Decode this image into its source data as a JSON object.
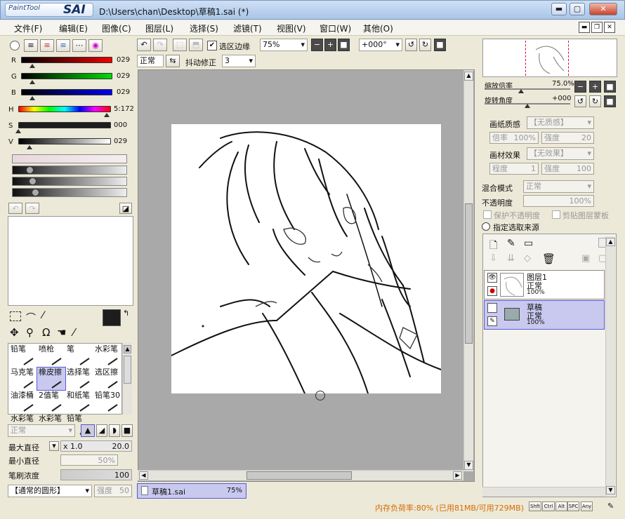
{
  "window": {
    "app_logo_small": "PaintTool",
    "app_logo_big": "SAI",
    "title": "D:\\Users\\chan\\Desktop\\草稿1.sai (*)",
    "btn_min": "▬",
    "btn_max": "▢",
    "btn_close": "✕"
  },
  "menu": {
    "items": [
      "文件(F)",
      "编辑(E)",
      "图像(C)",
      "图层(L)",
      "选择(S)",
      "滤镜(T)",
      "视图(V)",
      "窗口(W)",
      "其他(O)"
    ]
  },
  "toolbar": {
    "selection_edge_label": "选区边缘",
    "zoom_value": "75%",
    "rotation_value": "+000°",
    "blend_mode": "正常",
    "stabilizer_label": "抖动修正",
    "stabilizer_value": "3"
  },
  "color": {
    "r_label": "R",
    "r_value": "029",
    "g_label": "G",
    "g_value": "029",
    "b_label": "B",
    "b_value": "029",
    "h_label": "H",
    "h_value": "5:172",
    "s_label": "S",
    "s_value": "000",
    "v_label": "V",
    "v_value": "029",
    "primary": "#1d1d1d",
    "secondary": "#ffffff"
  },
  "tools": {
    "row1": [
      "铅笔",
      "喷枪",
      "笔",
      "水彩笔"
    ],
    "row2": [
      "马克笔",
      "橡皮擦",
      "选择笔",
      "选区擦"
    ],
    "row3": [
      "油漆桶",
      "2值笔",
      "和纸笔",
      "铅笔30"
    ],
    "row4": [
      "水彩笔",
      "水彩笔",
      "铅笔"
    ],
    "selected": "橡皮擦"
  },
  "brush": {
    "mode": "正常",
    "max_size_label": "最大直径",
    "max_size_mult": "x 1.0",
    "max_size_value": "20.0",
    "min_size_label": "最小直径",
    "min_size_value": "50%",
    "density_label": "笔刷浓度",
    "density_value": "100",
    "shape_label": "【通常的圆形】",
    "strength_label": "强度",
    "strength_value": "50"
  },
  "document_tab": {
    "name": "草稿1.sai",
    "zoom": "75%"
  },
  "status": {
    "text": "内存负荷率:80% (已用81MB/可用729MB)",
    "keys": [
      "Shft",
      "Ctrl",
      "Alt",
      "SPC",
      "Any"
    ]
  },
  "navigator": {
    "zoom_label": "缩放倍率",
    "zoom_value": "75.0%",
    "rotate_label": "旋转角度",
    "rotate_value": "+000"
  },
  "layer_props": {
    "paper_texture_label": "画纸质感",
    "paper_texture_value": "【无质感】",
    "ratio_label": "倍率",
    "ratio_value": "100%",
    "strength_label": "强度",
    "strength_value": "20",
    "effect_label": "画材效果",
    "effect_value": "【无效果】",
    "degree_label": "程度",
    "degree_value": "1",
    "strength2_label": "强度",
    "strength2_value": "100",
    "blend_label": "混合模式",
    "blend_value": "正常",
    "opacity_label": "不透明度",
    "opacity_value": "100%",
    "protect_label": "保护不透明度",
    "clip_label": "剪贴图层蒙板",
    "source_label": "指定选取来源"
  },
  "layers": [
    {
      "name": "图层1",
      "mode": "正常",
      "opacity": "100%",
      "type": "layer"
    },
    {
      "name": "草稿",
      "mode": "正常",
      "opacity": "100%",
      "type": "folder"
    }
  ]
}
